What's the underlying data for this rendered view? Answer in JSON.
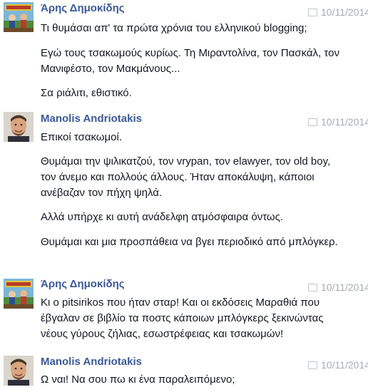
{
  "messages": [
    {
      "author": "Άρης Δημοκίδης",
      "timestamp": "10/11/2014",
      "avatar_icon": "comic-avatar-icon",
      "paragraphs": [
        "Τι θυμάσαι απ' τα πρώτα χρόνια του ελληνικού blogging;",
        "Εγώ τους τσακωμούς κυρίως. Τη Μιραντολίνα, τον Πασκάλ, τον Μανιφέστο, τον Μακμάνους...",
        "Σα ριάλιτι, εθιστικό."
      ]
    },
    {
      "author": "Manolis Andriotakis",
      "timestamp": "10/11/2014",
      "avatar_icon": "man-portrait-avatar-icon",
      "paragraphs": [
        "Επικοί τσακωμοί.",
        "Θυμάμαι την ψιλικατζού, τον vrypan, τον elawyer, τον old boy, τον άνεμο και πολλούς άλλους. Ήταν αποκάλυψη, κάποιοι ανέβαζαν τον πήχη ψηλά.",
        "Αλλά υπήρχε κι αυτή ανάδελφη ατμόσφαιρα όντως.",
        "Θυμάμαι και μια προσπάθεια να βγει περιοδικό από μπλόγκερ."
      ]
    },
    {
      "author": "Άρης Δημοκίδης",
      "timestamp": "10/11/2014",
      "avatar_icon": "comic-avatar-icon",
      "paragraphs": [
        "Κι ο pitsirikos που ήταν σταρ! Και οι εκδόσεις Μαραθιά που έβγαλαν σε βιβλίο τα ποστς κάποιων μπλόγκερς ξεκινώντας νέους γύρους ζήλιας, εσωστρέφειας και τσακωμών!"
      ]
    },
    {
      "author": "Manolis Andriotakis",
      "timestamp": "10/11/2014",
      "avatar_icon": "man-portrait-avatar-icon",
      "paragraphs": [
        "Ω ναι! Να σου πω κι ένα παραλειπόμενο;"
      ]
    }
  ]
}
